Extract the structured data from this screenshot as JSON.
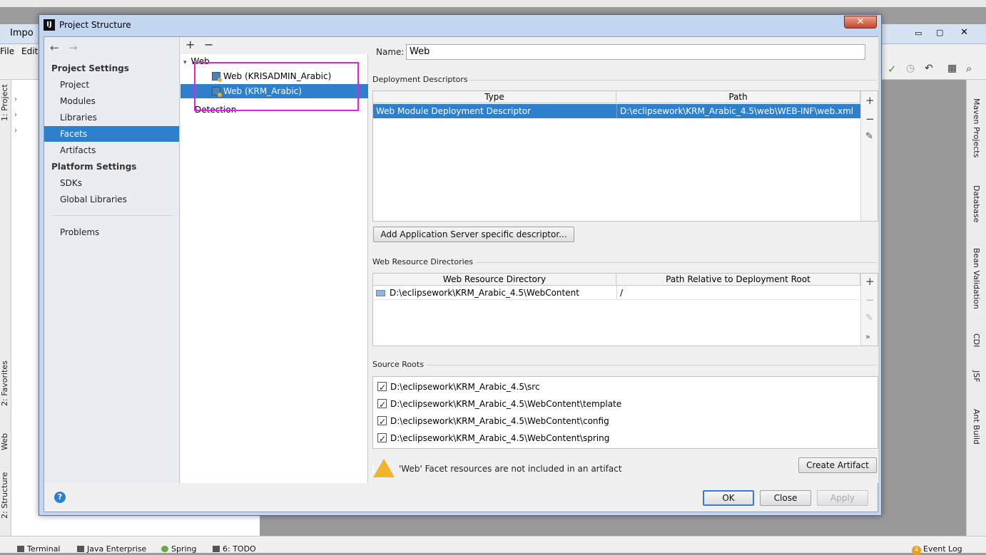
{
  "ide": {
    "title": "Impo",
    "menu": [
      "File",
      "Edit"
    ],
    "left_tabs": [
      "1: Project",
      "2: Favorites",
      "Web",
      "2: Structure"
    ],
    "right_tabs": [
      "Maven Projects",
      "Database",
      "Bean Validation",
      "CDI",
      "JSF",
      "Ant Build"
    ],
    "bottom_tabs": [
      "Terminal",
      "Java Enterprise",
      "Spring",
      "6: TODO"
    ],
    "event_log": "Event Log",
    "event_log_count": "4"
  },
  "dialog": {
    "title": "Project Structure",
    "close_label": "✕",
    "nav": {
      "project_settings_header": "Project Settings",
      "project_settings": [
        "Project",
        "Modules",
        "Libraries",
        "Facets",
        "Artifacts"
      ],
      "platform_settings_header": "Platform Settings",
      "platform_settings": [
        "SDKs",
        "Global Libraries"
      ],
      "problems": "Problems",
      "selected": "Facets"
    },
    "tree": {
      "add": "+",
      "remove": "−",
      "group": "Web",
      "items": [
        "Web (KRISADMIN_Arabic)",
        "Web (KRM_Arabic)"
      ],
      "selected_index": 1,
      "detection": "Detection"
    },
    "facet": {
      "name_label": "Name:",
      "name_value": "Web",
      "deployment_descriptors": {
        "section": "Deployment Descriptors",
        "columns": [
          "Type",
          "Path"
        ],
        "rows": [
          {
            "type": "Web Module Deployment Descriptor",
            "path": "D:\\eclipsework\\KRM_Arabic_4.5\\web\\WEB-INF\\web.xml"
          }
        ],
        "add_server_descriptor": "Add Application Server specific descriptor..."
      },
      "web_resource_directories": {
        "section": "Web Resource Directories",
        "columns": [
          "Web Resource Directory",
          "Path Relative to Deployment Root"
        ],
        "rows": [
          {
            "dir": "D:\\eclipsework\\KRM_Arabic_4.5\\WebContent",
            "rel": "/"
          }
        ]
      },
      "source_roots": {
        "section": "Source Roots",
        "items": [
          "D:\\eclipsework\\KRM_Arabic_4.5\\src",
          "D:\\eclipsework\\KRM_Arabic_4.5\\WebContent\\template",
          "D:\\eclipsework\\KRM_Arabic_4.5\\WebContent\\config",
          "D:\\eclipsework\\KRM_Arabic_4.5\\WebContent\\spring"
        ]
      },
      "warning": "'Web' Facet resources are not included in an artifact",
      "create_artifact": "Create Artifact"
    },
    "buttons": {
      "ok": "OK",
      "close": "Close",
      "apply": "Apply"
    },
    "help": "?"
  }
}
